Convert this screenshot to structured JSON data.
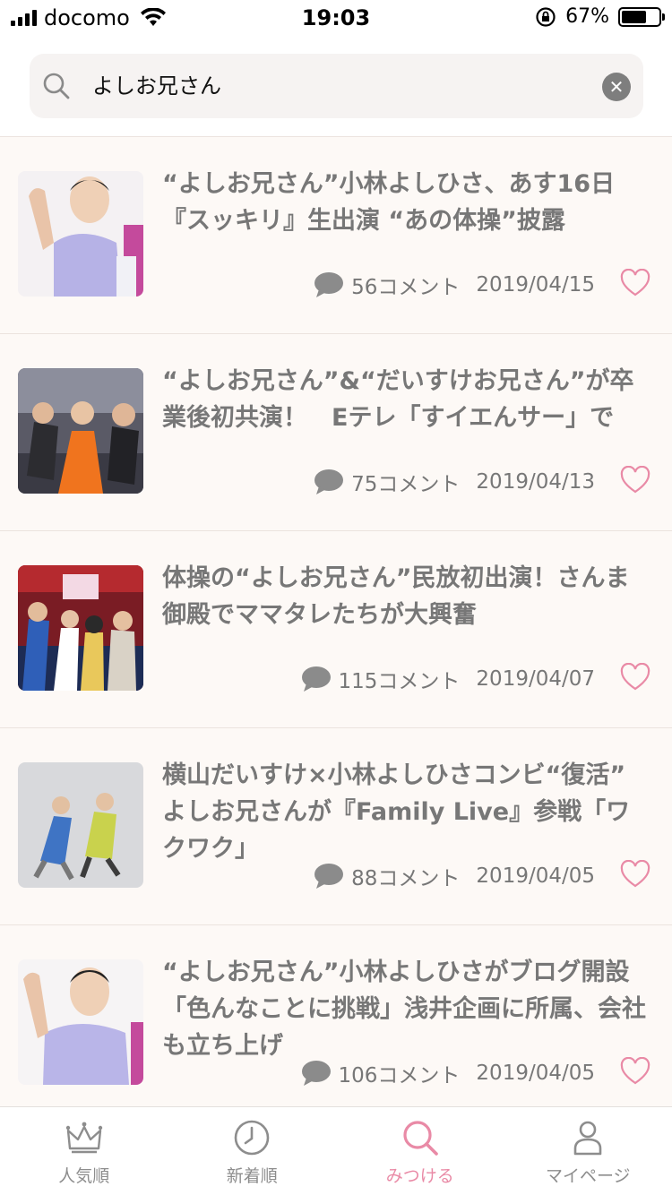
{
  "status_bar": {
    "carrier": "docomo",
    "time": "19:03",
    "battery_percent": "67%",
    "battery_level": 0.67
  },
  "search": {
    "query": "よしお兄さん"
  },
  "articles": [
    {
      "title": "“よしお兄さん”小林よしひさ、あす16日『スッキリ』生出演 “あの体操”披露",
      "comments": "56コメント",
      "date": "2019/04/15"
    },
    {
      "title": "“よしお兄さん”&“だいすけお兄さん”が卒業後初共演！　Eテレ「すイエんサー」で",
      "comments": "75コメント",
      "date": "2019/04/13"
    },
    {
      "title": "体操の“よしお兄さん”民放初出演！さんま御殿でママタレたちが大興奮",
      "comments": "115コメント",
      "date": "2019/04/07"
    },
    {
      "title": "横山だいすけ×小林よしひさコンビ“復活” よしお兄さんが『Family Live』参戦「ワクワク」",
      "comments": "88コメント",
      "date": "2019/04/05"
    },
    {
      "title": "“よしお兄さん”小林よしひさがブログ開設「色んなことに挑戦」浅井企画に所属、会社も立ち上げ",
      "comments": "106コメント",
      "date": "2019/04/05"
    }
  ],
  "tabs": [
    {
      "label": "人気順",
      "icon": "crown-icon"
    },
    {
      "label": "新着順",
      "icon": "clock-icon"
    },
    {
      "label": "みつける",
      "icon": "search-icon"
    },
    {
      "label": "マイページ",
      "icon": "person-icon"
    }
  ],
  "colors": {
    "accent": "#e98aa6",
    "text": "#777777",
    "list_bg": "#fdf9f6"
  }
}
